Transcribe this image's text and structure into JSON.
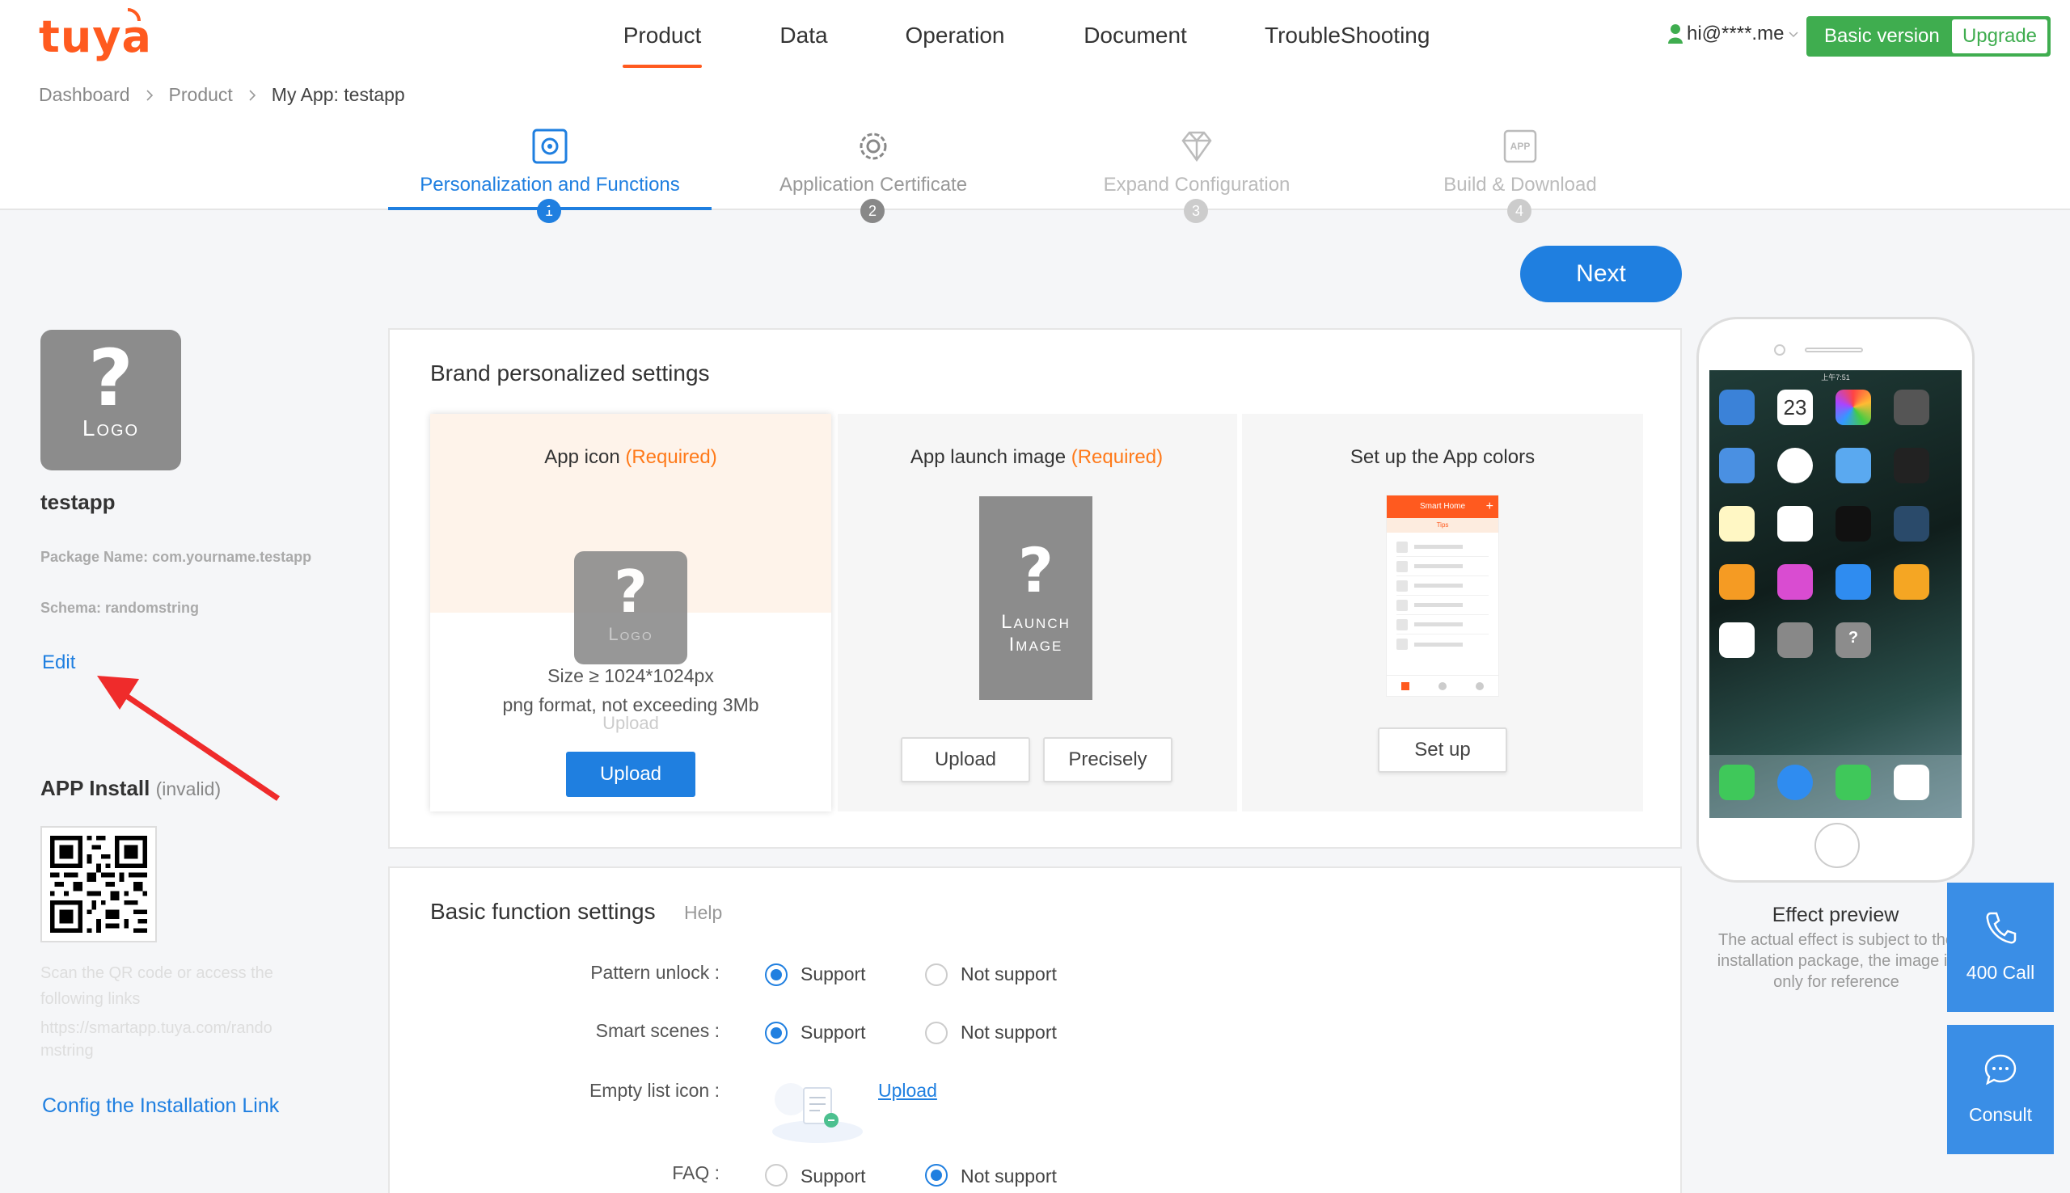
{
  "header": {
    "logo": "tuya",
    "nav": [
      "Product",
      "Data",
      "Operation",
      "Document",
      "TroubleShooting"
    ],
    "user": "hi@****.me",
    "plan_label": "Basic version",
    "upgrade_label": "Upgrade"
  },
  "breadcrumb": [
    "Dashboard",
    "Product",
    "My App: testapp"
  ],
  "steps": [
    {
      "label": "Personalization and Functions",
      "num": "1"
    },
    {
      "label": "Application Certificate",
      "num": "2"
    },
    {
      "label": "Expand Configuration",
      "num": "3"
    },
    {
      "label": "Build & Download",
      "num": "4"
    }
  ],
  "sidebar": {
    "logo_q": "?",
    "logo_text": "Logo",
    "app_name": "testapp",
    "package_name": "Package Name: com.yourname.testapp",
    "schema": "Schema: randomstring",
    "edit_label": "Edit",
    "install_title": "APP Install",
    "install_status": "(invalid)",
    "scan_text": "Scan the QR code or access the following links",
    "link_text": "https://smartapp.tuya.com/randomstring",
    "config_link": "Config the Installation Link"
  },
  "next_label": "Next",
  "brand": {
    "title": "Brand personalized settings",
    "app_icon_title": "App icon ",
    "required": "(Required)",
    "ghost_logo_q": "?",
    "ghost_logo_text": "Logo",
    "size_line1": "Size ≥ 1024*1024px",
    "size_line2": "png format, not exceeding 3Mb",
    "ghost_upload": "Upload",
    "upload_label": "Upload",
    "launch_title": "App launch image ",
    "launch_q": "?",
    "launch_line1": "Launch",
    "launch_line2": "Image",
    "launch_upload": "Upload",
    "precisely": "Precisely",
    "colors_title": "Set up the App colors",
    "colors_header": "Smart Home",
    "colors_tab": "Tips",
    "setup_label": "Set up"
  },
  "basic": {
    "title": "Basic function settings",
    "help": "Help",
    "rows": [
      {
        "label": "Pattern unlock :",
        "opt1": "Support",
        "opt2": "Not support",
        "selected": "opt1"
      },
      {
        "label": "Smart scenes :",
        "opt1": "Support",
        "opt2": "Not support",
        "selected": "opt1"
      },
      {
        "label": "FAQ :",
        "opt1": "Support",
        "opt2": "Not support",
        "selected": "opt2"
      }
    ],
    "empty_icon_label": "Empty list icon :",
    "empty_upload": "Upload"
  },
  "preview": {
    "title": "Effect preview",
    "note_line1": "The actual effect is subject to the",
    "note_line2": "installation package, the image is",
    "note_line3": "only for reference",
    "phone_status": "上午7:51",
    "phone_date": "23"
  },
  "float": {
    "call_label": "400 Call",
    "consult_label": "Consult"
  },
  "colors": {
    "accent": "#1f7fe0",
    "brand": "#ff5a1f",
    "plan": "#3fad4f",
    "required": "#ff7a1a"
  }
}
